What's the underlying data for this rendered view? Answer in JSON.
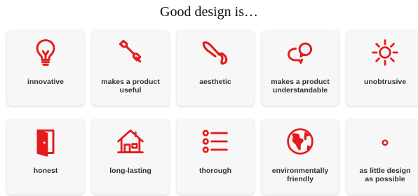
{
  "page": {
    "title": "Good design is…"
  },
  "accent_color": "#e31b1b",
  "cards": [
    {
      "label": "innovative",
      "icon": "lightbulb-icon"
    },
    {
      "label": "makes a product\nuseful",
      "icon": "wrench-icon"
    },
    {
      "label": "aesthetic",
      "icon": "paintbrush-icon"
    },
    {
      "label": "makes a product\nunderstandable",
      "icon": "speech-bubbles-icon"
    },
    {
      "label": "unobtrusive",
      "icon": "sun-icon"
    },
    {
      "label": "honest",
      "icon": "open-door-icon"
    },
    {
      "label": "long-lasting",
      "icon": "house-icon"
    },
    {
      "label": "thorough",
      "icon": "list-icon"
    },
    {
      "label": "environmentally\nfriendly",
      "icon": "globe-icon"
    },
    {
      "label": "as little design\nas possible",
      "icon": "dot-icon"
    }
  ]
}
